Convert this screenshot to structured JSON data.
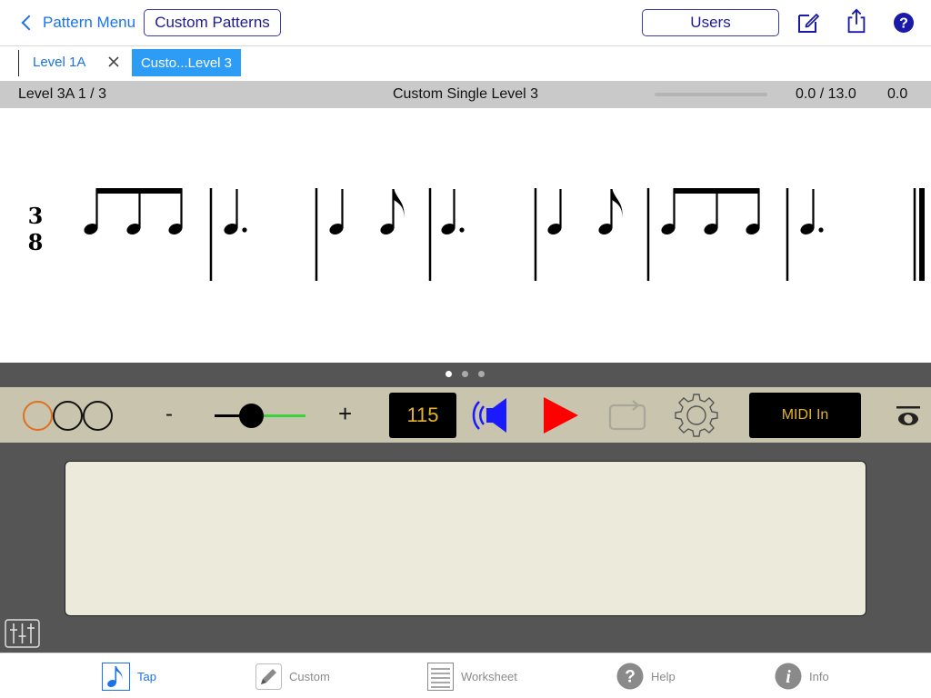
{
  "nav": {
    "back_label": "Pattern Menu",
    "custom_patterns_label": "Custom Patterns",
    "users_label": "Users"
  },
  "tabs": {
    "first_label": "Level 1A",
    "close_symbol": "✕",
    "active_label": "Custo...Level 3"
  },
  "status": {
    "left": "Level 3A 1 / 3",
    "center": "Custom Single Level 3",
    "progress_fraction": 0.0,
    "time": "0.0 / 13.0",
    "score": "0.0"
  },
  "notation": {
    "time_signature_top": "3",
    "time_signature_bottom": "8"
  },
  "pager": {
    "page_count": 3,
    "current_page": 1
  },
  "controls": {
    "volume_minus": "-",
    "volume_plus": "+",
    "volume_level": 0.4,
    "tempo": "115",
    "midi_label": "MIDI In",
    "accent_color": "#e5b32b",
    "play_color": "#ff0000",
    "speaker_color": "#1a1aff",
    "slider_color": "#3bd33b",
    "count_in_active_color": "#e07020"
  },
  "tabbar": {
    "items": [
      {
        "label": "Tap",
        "icon": "eighth-note-icon"
      },
      {
        "label": "Custom",
        "icon": "pencil-icon"
      },
      {
        "label": "Worksheet",
        "icon": "worksheet-icon"
      },
      {
        "label": "Help",
        "icon": "help-icon"
      },
      {
        "label": "Info",
        "icon": "info-icon"
      }
    ],
    "active_color": "#1a73e8"
  }
}
